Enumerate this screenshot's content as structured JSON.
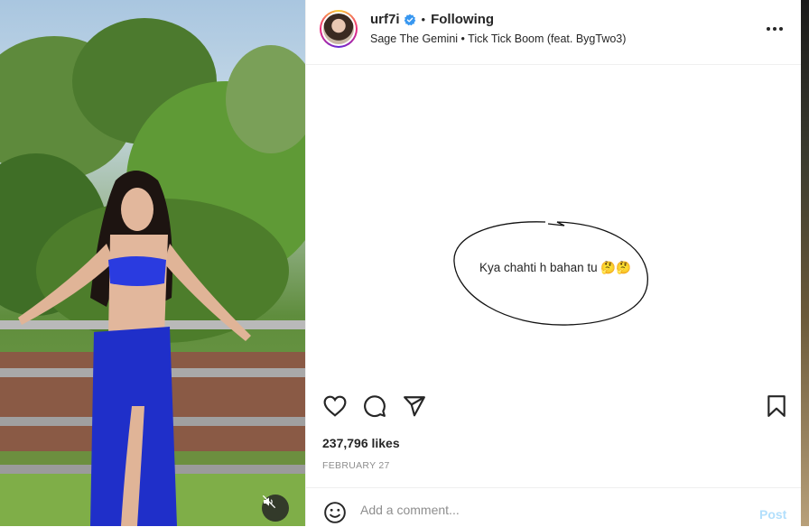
{
  "post": {
    "username": "urf7i",
    "separator": "•",
    "follow_status": "Following",
    "audio": "Sage The Gemini • Tick Tick Boom (feat. BygTwo3)",
    "comment": {
      "text": "Kya chahti h bahan tu 🤔🤔"
    },
    "likes": "237,796 likes",
    "date": "FEBRUARY 27",
    "add_comment_placeholder": "Add a comment...",
    "post_label": "Post"
  },
  "icons": {
    "verified": "verified-badge-icon",
    "more": "more-options-icon",
    "like": "heart-icon",
    "comment": "comment-bubble-icon",
    "share": "paper-plane-icon",
    "save": "bookmark-icon",
    "emoji": "emoji-smiley-icon",
    "mute": "speaker-muted-icon"
  },
  "colors": {
    "verified": "#3897f0",
    "post_disabled": "#b2dffc",
    "secondary_text": "#8e8e8e",
    "outfit": "#1f2fc9"
  }
}
